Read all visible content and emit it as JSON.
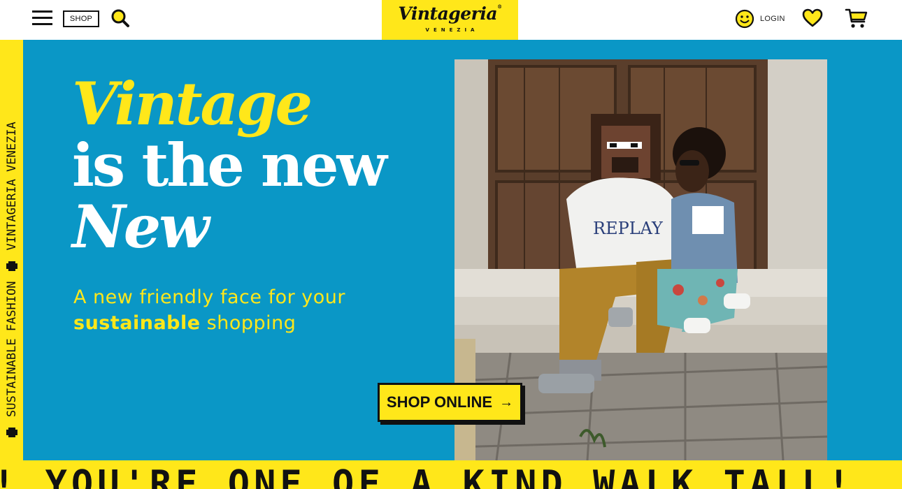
{
  "header": {
    "shop_label": "SHOP",
    "logo_text": "Vintageria",
    "logo_registered": "®",
    "logo_sub": "VENEZIA",
    "login_label": "LOGIN"
  },
  "side_strip": {
    "items": [
      "SUSTAINABLE FASHION",
      "VINTAGERIA VENEZIA"
    ]
  },
  "hero": {
    "headline_1": "Vintage",
    "headline_2": "is the new",
    "headline_3": "New",
    "tagline_1": "A new friendly face for your",
    "tagline_bold": "sustainable",
    "tagline_2": " shopping",
    "cta_label": "SHOP ONLINE",
    "cta_arrow": "→"
  },
  "marquee": {
    "text": "! YOU'RE ONE OF A KIND  WALK TALL!"
  },
  "colors": {
    "yellow": "#ffe71a",
    "blue": "#0a97c6",
    "ink": "#111111"
  },
  "icons": [
    "menu-icon",
    "search-icon",
    "smile-icon",
    "heart-icon",
    "cart-icon",
    "arrow-right-icon"
  ]
}
